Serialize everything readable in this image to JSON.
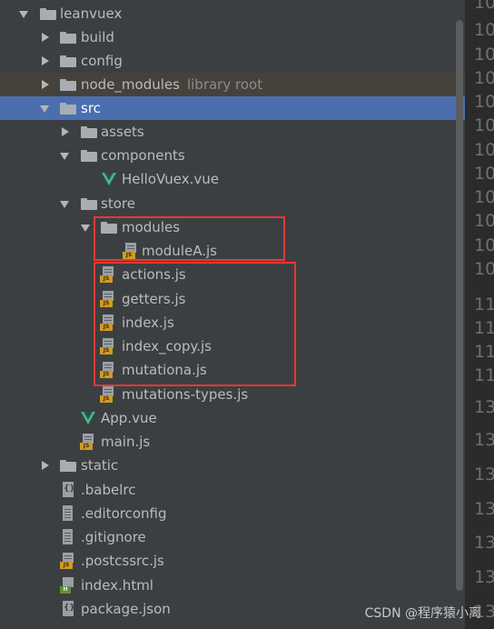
{
  "tree": {
    "items": [
      {
        "label": "leanvuex",
        "icon": "folder-icon"
      },
      {
        "label": "build",
        "icon": "folder-icon"
      },
      {
        "label": "config",
        "icon": "folder-icon"
      },
      {
        "label": "node_modules",
        "hint": "library root",
        "icon": "folder-icon"
      },
      {
        "label": "src",
        "icon": "folder-icon"
      },
      {
        "label": "assets",
        "icon": "folder-icon"
      },
      {
        "label": "components",
        "icon": "folder-icon"
      },
      {
        "label": "HelloVuex.vue",
        "icon": "vue-file-icon"
      },
      {
        "label": "store",
        "icon": "folder-icon"
      },
      {
        "label": "modules",
        "icon": "folder-icon"
      },
      {
        "label": "moduleA.js",
        "icon": "js-file-icon"
      },
      {
        "label": "actions.js",
        "icon": "js-file-icon"
      },
      {
        "label": "getters.js",
        "icon": "js-file-icon"
      },
      {
        "label": "index.js",
        "icon": "js-file-icon"
      },
      {
        "label": "index_copy.js",
        "icon": "js-file-icon"
      },
      {
        "label": "mutationa.js",
        "icon": "js-file-icon"
      },
      {
        "label": "mutations-types.js",
        "icon": "js-file-icon"
      },
      {
        "label": "App.vue",
        "icon": "vue-file-icon"
      },
      {
        "label": "main.js",
        "icon": "js-file-icon"
      },
      {
        "label": "static",
        "icon": "folder-icon"
      },
      {
        "label": ".babelrc",
        "icon": "json-file-icon"
      },
      {
        "label": ".editorconfig",
        "icon": "config-file-icon"
      },
      {
        "label": ".gitignore",
        "icon": "config-file-icon"
      },
      {
        "label": ".postcssrc.js",
        "icon": "js-file-icon"
      },
      {
        "label": "index.html",
        "icon": "html-file-icon"
      },
      {
        "label": "package.json",
        "icon": "json-file-icon"
      }
    ]
  },
  "gutter": {
    "line_numbers": [
      "10",
      "10",
      "10",
      "10",
      "10",
      "10",
      "10",
      "10",
      "10",
      "10",
      "10",
      "10",
      "11",
      "11",
      "11",
      "11",
      "13",
      "13",
      "13",
      "13",
      "13",
      "13",
      "13",
      "13",
      "13",
      "13",
      "13"
    ]
  },
  "colors": {
    "panel_bg": "#3c3f41",
    "selection": "#4b6eaf",
    "highlight_box": "#e53935",
    "vue_green": "#41b883",
    "js_badge": "#d09a25"
  },
  "watermark": "CSDN @程序猿小离"
}
